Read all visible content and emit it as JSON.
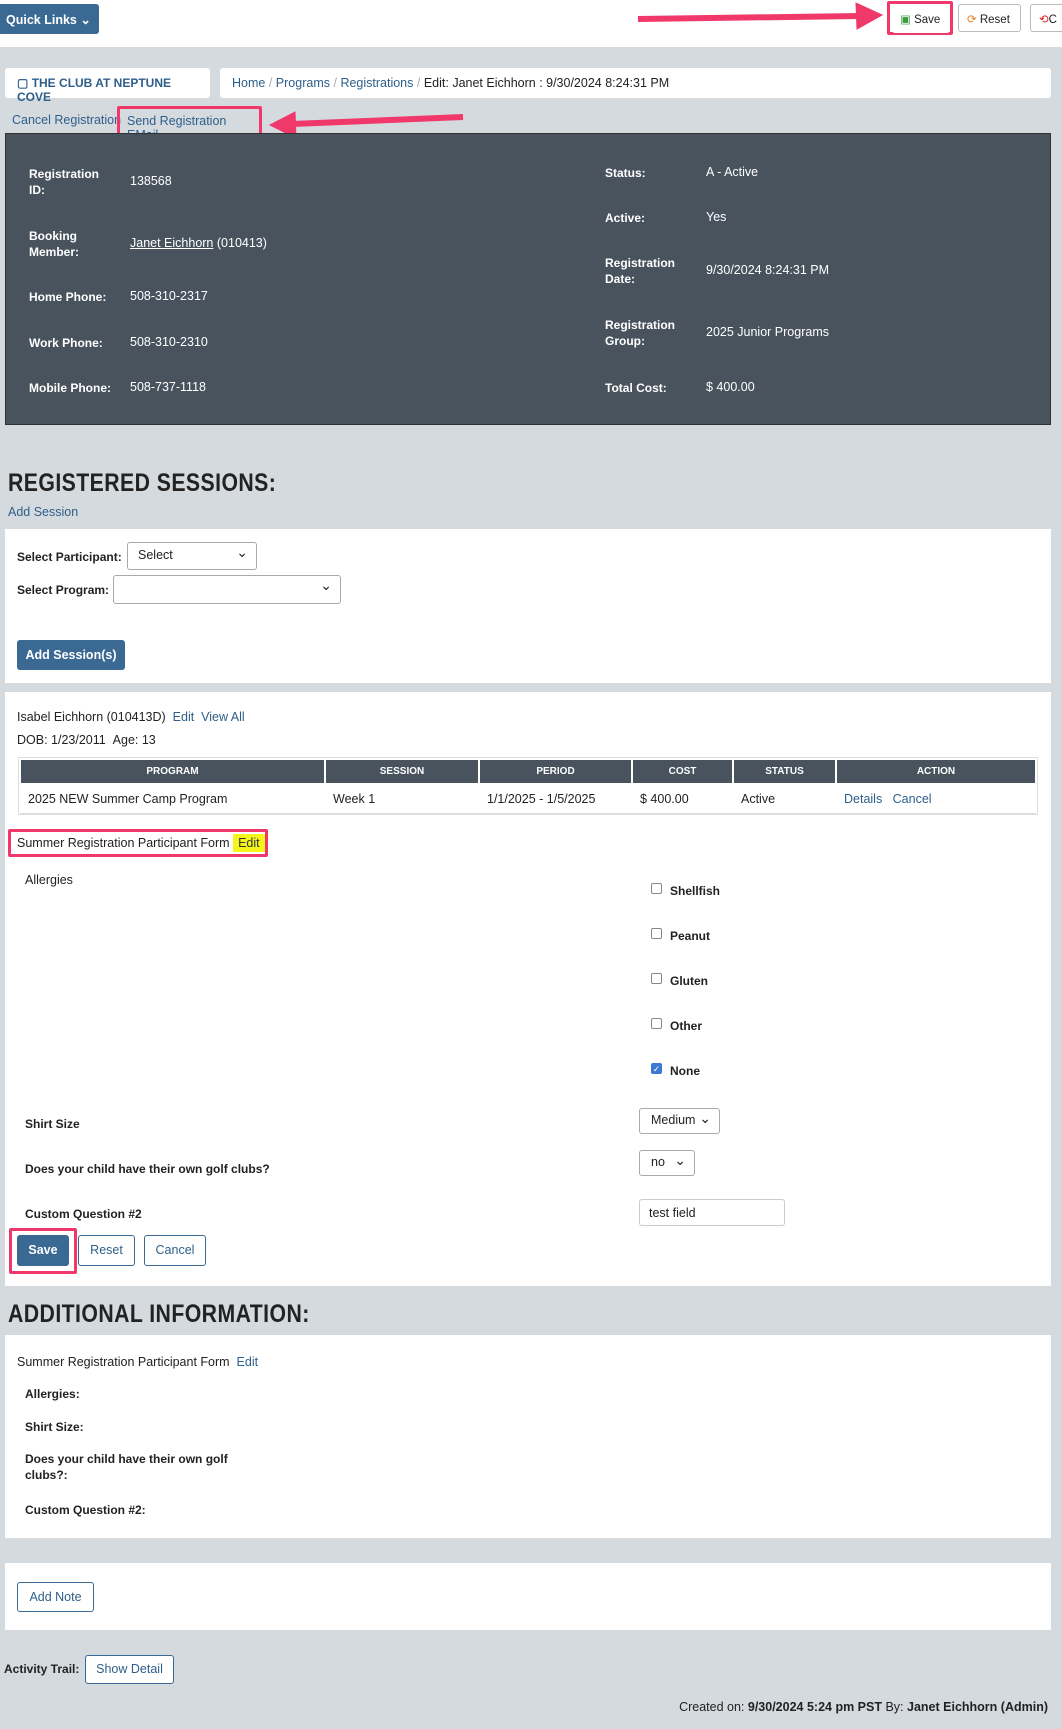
{
  "toolbar": {
    "quick_links": "Quick Links",
    "save": "Save",
    "reset": "Reset",
    "close": "C"
  },
  "breadcrumb": {
    "club": "THE CLUB AT NEPTUNE COVE",
    "items": [
      "Home",
      "Programs",
      "Registrations"
    ],
    "current": "Edit: Janet Eichhorn : 9/30/2024 8:24:31 PM"
  },
  "actions": {
    "cancel_registration": "Cancel Registration",
    "send_email": "Send Registration EMail"
  },
  "details": {
    "left": [
      {
        "label": "Registration ID:",
        "value": "138568"
      },
      {
        "label": "Booking Member:",
        "value": "Janet Eichhorn",
        "extra": "(010413)"
      },
      {
        "label": "Home Phone:",
        "value": "508-310-2317"
      },
      {
        "label": "Work Phone:",
        "value": "508-310-2310"
      },
      {
        "label": "Mobile Phone:",
        "value": "508-737-1118"
      }
    ],
    "right": [
      {
        "label": "Status:",
        "value": "A - Active"
      },
      {
        "label": "Active:",
        "value": "Yes"
      },
      {
        "label": "Registration Date:",
        "value": "9/30/2024 8:24:31 PM"
      },
      {
        "label": "Registration Group:",
        "value": "2025 Junior Programs"
      },
      {
        "label": "Total Cost:",
        "value": "$ 400.00"
      }
    ]
  },
  "sessions": {
    "title": "REGISTERED SESSIONS:",
    "add_session": "Add Session",
    "participant_label": "Select Participant:",
    "participant_value": "Select",
    "program_label": "Select Program:",
    "program_value": "",
    "add_button": "Add Session(s)"
  },
  "participant": {
    "name": "Isabel Eichhorn (010413D)",
    "edit": "Edit",
    "view_all": "View All",
    "dob": "DOB: 1/23/2011",
    "age": "Age: 13",
    "columns": [
      "PROGRAM",
      "SESSION",
      "PERIOD",
      "COST",
      "STATUS",
      "ACTION"
    ],
    "rows": [
      {
        "program": "2025 NEW Summer Camp Program",
        "session": "Week 1",
        "period": "1/1/2025 - 1/5/2025",
        "cost": "$ 400.00",
        "status": "Active",
        "details": "Details",
        "cancel": "Cancel"
      }
    ]
  },
  "form": {
    "title": "Summer Registration Participant Form",
    "edit": "Edit",
    "allergies_label": "Allergies",
    "allergies": [
      {
        "label": "Shellfish",
        "checked": false
      },
      {
        "label": "Peanut",
        "checked": false
      },
      {
        "label": "Gluten",
        "checked": false
      },
      {
        "label": "Other",
        "checked": false
      },
      {
        "label": "None",
        "checked": true
      }
    ],
    "shirt_label": "Shirt Size",
    "shirt_value": "Medium",
    "golf_label": "Does your child have their own golf clubs?",
    "golf_value": "no",
    "custom_label": "Custom Question #2",
    "custom_value": "test field",
    "save": "Save",
    "reset": "Reset",
    "cancel": "Cancel"
  },
  "additional": {
    "title": "ADDITIONAL INFORMATION:",
    "form_title": "Summer Registration Participant Form",
    "edit": "Edit",
    "allergies": "Allergies:",
    "shirt": "Shirt Size:",
    "golf": "Does your child have their own golf clubs?:",
    "custom": "Custom Question #2:"
  },
  "notes": {
    "add_note": "Add Note"
  },
  "activity": {
    "label": "Activity Trail:",
    "show_detail": "Show Detail"
  },
  "footer": {
    "created_prefix": "Created on:",
    "created_on": "9/30/2024 5:24 pm PST",
    "by_prefix": "By:",
    "by": "Janet Eichhorn (Admin)"
  },
  "colors": {
    "accent": "#3a6a93",
    "panel": "#48535e",
    "highlight": "#f0386a",
    "edit_highlight": "#f5f51a"
  }
}
